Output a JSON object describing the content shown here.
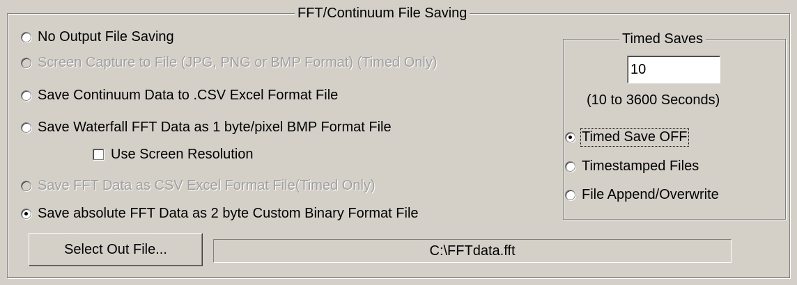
{
  "main_group": {
    "title": "FFT/Continuum File Saving",
    "options": [
      {
        "label": "No Output File Saving",
        "enabled": true,
        "selected": false
      },
      {
        "label": "Screen Capture to File (JPG, PNG or BMP Format) (Timed Only)",
        "enabled": false,
        "selected": false
      },
      {
        "label": "Save Continuum Data to .CSV Excel Format File",
        "enabled": true,
        "selected": false
      },
      {
        "label": "Save Waterfall FFT Data as 1 byte/pixel BMP Format File",
        "enabled": true,
        "selected": false
      },
      {
        "label": "Save FFT Data as CSV Excel  Format File(Timed Only)",
        "enabled": false,
        "selected": false
      },
      {
        "label": "Save absolute FFT Data as 2 byte Custom Binary Format File",
        "enabled": true,
        "selected": true
      }
    ],
    "checkbox": {
      "label": "Use Screen Resolution",
      "checked": false
    },
    "select_button": "Select Out File...",
    "file_path": "C:\\FFTdata.fft"
  },
  "timed_group": {
    "title": "Timed Saves",
    "interval_value": "10",
    "range_text": "(10 to 3600 Seconds)",
    "options": [
      {
        "label": "Timed Save OFF",
        "selected": true
      },
      {
        "label": "Timestamped Files",
        "selected": false
      },
      {
        "label": "File Append/Overwrite",
        "selected": false
      }
    ]
  }
}
